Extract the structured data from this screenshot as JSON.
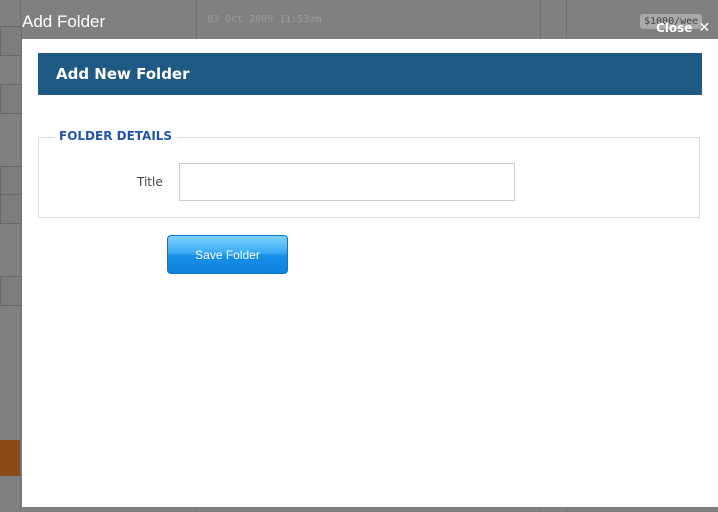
{
  "background": {
    "date_text": "03 Oct 2009 11:53am",
    "price_text": "$1000/wee"
  },
  "modal": {
    "title": "Add Folder",
    "close_label": "Close",
    "close_glyph": "✕",
    "header_title": "Add New Folder",
    "section_legend": "FOLDER DETAILS",
    "title_field": {
      "label": "Title",
      "value": "",
      "placeholder": ""
    },
    "save_button_label": "Save Folder"
  },
  "colors": {
    "overlay": "#7f7f7f",
    "header_bar": "#1f5a85",
    "legend_text": "#2255aa",
    "button_blue": "#168ee6"
  }
}
